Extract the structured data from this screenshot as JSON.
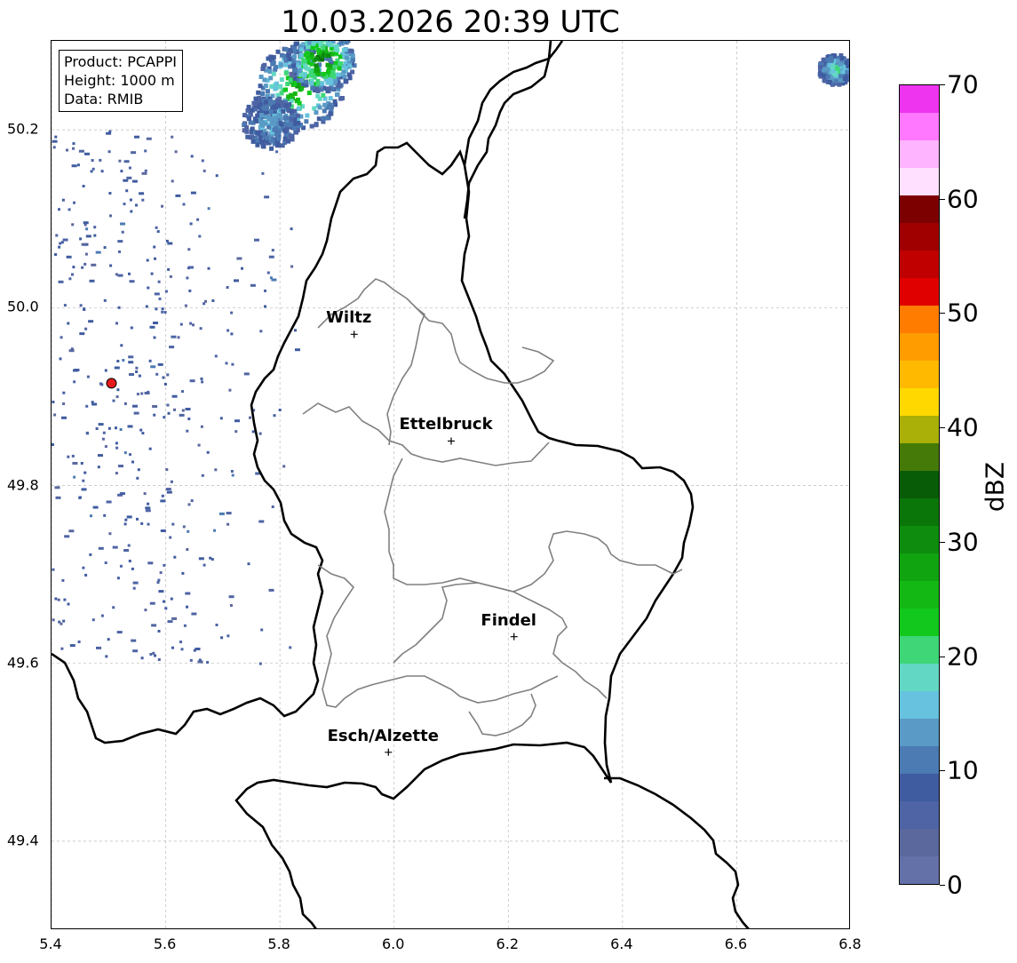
{
  "title": "10.03.2026 20:39 UTC",
  "info_box": {
    "product": "Product: PCAPPI",
    "height": "Height: 1000 m",
    "data": "Data: RMIB"
  },
  "axes": {
    "x_ticks": [
      "5.4",
      "5.6",
      "5.8",
      "6.0",
      "6.2",
      "6.4",
      "6.6",
      "6.8"
    ],
    "y_ticks": [
      "50.2",
      "50.0",
      "49.8",
      "49.6",
      "49.4"
    ],
    "lon_range": [
      5.4,
      6.8
    ],
    "lat_range": [
      49.3,
      50.3
    ],
    "grid": true
  },
  "cities": [
    {
      "name": "Wiltz",
      "lon": 5.93,
      "lat": 49.97
    },
    {
      "name": "Ettelbruck",
      "lon": 6.1,
      "lat": 49.85
    },
    {
      "name": "Findel",
      "lon": 6.21,
      "lat": 49.63
    },
    {
      "name": "Esch/Alzette",
      "lon": 5.99,
      "lat": 49.5
    }
  ],
  "radar_site": {
    "lon": 5.505,
    "lat": 49.915,
    "color": "#e41a1c"
  },
  "colorbar": {
    "label": "dBZ",
    "min": 0,
    "max": 70,
    "ticks": [
      "0",
      "10",
      "20",
      "30",
      "40",
      "50",
      "60",
      "70"
    ],
    "colors": [
      "#6470a8",
      "#5a689e",
      "#4e64a4",
      "#405ca0",
      "#4c7ab2",
      "#5a9ac6",
      "#66c2de",
      "#62d8c4",
      "#3ed676",
      "#12c81c",
      "#14b814",
      "#10a410",
      "#0e8c0e",
      "#0a760a",
      "#085c08",
      "#467a08",
      "#aab008",
      "#ffd800",
      "#ffba00",
      "#ff9c00",
      "#ff7c00",
      "#e00000",
      "#c00000",
      "#a00000",
      "#7c0000",
      "#ffe0ff",
      "#ffb4ff",
      "#ff78ff",
      "#ee34ee"
    ]
  },
  "precipitation": {
    "cells": [
      {
        "lon": 5.83,
        "lat": 50.25,
        "size": 0.08,
        "dbz": 22
      },
      {
        "lon": 5.87,
        "lat": 50.28,
        "size": 0.06,
        "dbz": 28
      },
      {
        "lon": 5.78,
        "lat": 50.21,
        "size": 0.05,
        "dbz": 8
      },
      {
        "lon": 6.77,
        "lat": 50.27,
        "size": 0.03,
        "dbz": 14
      }
    ],
    "clutter_area": {
      "lon_min": 5.4,
      "lon_max": 5.85,
      "lat_min": 49.6,
      "lat_max": 50.2,
      "dbz": 4
    }
  }
}
